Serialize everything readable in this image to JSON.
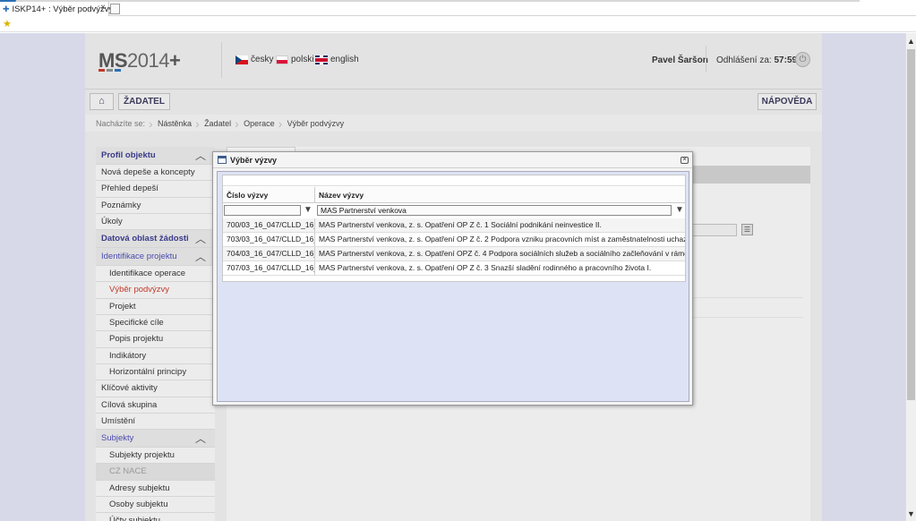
{
  "browser": {
    "tab_title": "ISKP14+ : Výběr podvýzvy",
    "close_glyph": "×"
  },
  "header": {
    "logo_ms": "MS",
    "logo_year": "2014",
    "logo_plus": "+",
    "logo_colors": [
      "#c0392b",
      "#7f8c8d",
      "#2d6fb5"
    ],
    "languages": [
      "česky",
      "polski",
      "english"
    ],
    "user_name": "Pavel Šaršon",
    "logout_label": "Odhlášení za:",
    "logout_timer": "57:59"
  },
  "nav": {
    "applicant": "ŽADATEL",
    "help": "NÁPOVĚDA"
  },
  "breadcrumb": {
    "prefix": "Nacházíte se:",
    "items": [
      "Nástěnka",
      "Žadatel",
      "Operace",
      "Výběr podvýzvy"
    ]
  },
  "sidebar": {
    "profile_section": "Profil objektu",
    "new_messages": "Nová depeše a koncepty",
    "messages_overview": "Přehled depeší",
    "notes": "Poznámky",
    "tasks": "Úkoly",
    "data_section": "Datová oblast žádosti",
    "identification_section": "Identifikace projektu",
    "operation_identification": "Identifikace operace",
    "subcall_selection": "Výběr podvýzvy",
    "project": "Projekt",
    "specific_goals": "Specifické cíle",
    "project_description": "Popis projektu",
    "indicators": "Indikátory",
    "horizontal_principles": "Horizontální principy",
    "key_activities": "Klíčové aktivity",
    "target_group": "Cílová skupina",
    "location": "Umístění",
    "subjects_section": "Subjekty",
    "project_subjects": "Subjekty projektu",
    "cz_nace": "CZ NACE",
    "subject_addresses": "Adresy subjektu",
    "subject_persons": "Osoby subjektu",
    "subject_accounts": "Účty subjektu"
  },
  "modal": {
    "title": "Výběr výzvy",
    "columns": {
      "number": "Číslo výzvy",
      "name": "Název výzvy"
    },
    "filter": {
      "number_value": "",
      "name_value": "MAS Partnerství venkova"
    },
    "rows": [
      {
        "number": "700/03_16_047/CLLD_16_...",
        "name": "MAS Partnerství venkova, z. s. Opatření OP Z č. 1 Sociální podnikání neinvestice II."
      },
      {
        "number": "703/03_16_047/CLLD_16_...",
        "name": "MAS Partnerství venkova, z. s. Opatření OP Z č. 2 Podpora vzniku pracovních míst a zaměstnatelnosti uchazečů II."
      },
      {
        "number": "704/03_16_047/CLLD_16_...",
        "name": "MAS Partnerství venkova, z. s. Opatření OPZ č. 4 Podpora sociálních služeb a sociálního začleňování v rámci komunity II."
      },
      {
        "number": "707/03_16_047/CLLD_16_...",
        "name": "MAS Partnerství venkova, z. s. Opatření OP Z č. 3 Snazší sladění rodinného a pracovního života I."
      }
    ]
  }
}
